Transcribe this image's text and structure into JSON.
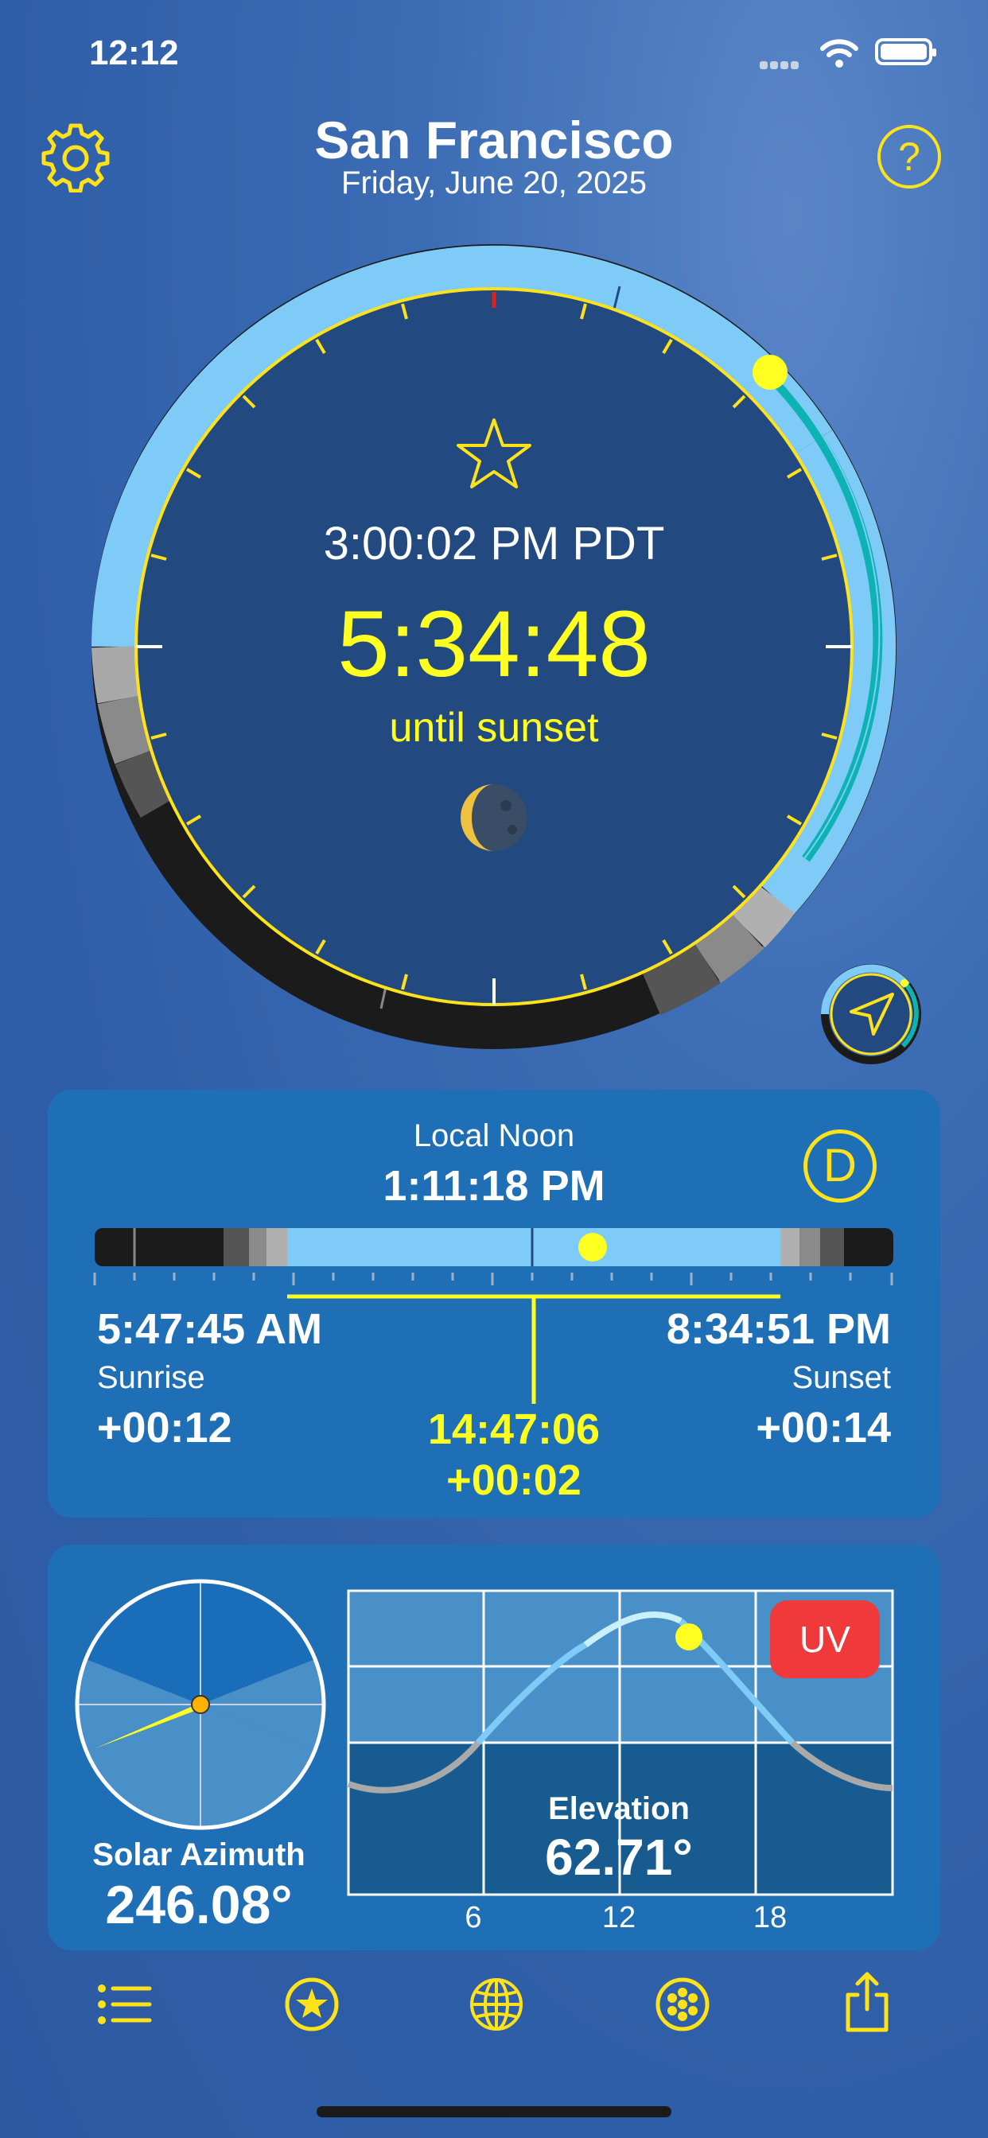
{
  "status": {
    "time": "12:12"
  },
  "header": {
    "city": "San Francisco",
    "date": "Friday, June 20, 2025",
    "help_label": "?"
  },
  "dial": {
    "clock_time": "3:00:02 PM PDT",
    "countdown": "5:34:48",
    "countdown_caption": "until sunset"
  },
  "day_panel": {
    "local_noon_label": "Local Noon",
    "local_noon_time": "1:11:18 PM",
    "mode_button": "D",
    "sunrise_time": "5:47:45 AM",
    "sunrise_label": "Sunrise",
    "sunrise_delta": "+00:12",
    "sunset_time": "8:34:51 PM",
    "sunset_label": "Sunset",
    "sunset_delta": "+00:14",
    "day_length": "14:47:06",
    "day_length_delta": "+00:02"
  },
  "sun_panel": {
    "azimuth_label": "Solar Azimuth",
    "azimuth_value": "246.08°",
    "uv_button": "UV",
    "elevation_label": "Elevation",
    "elevation_value": "62.71°",
    "x_ticks": [
      "6",
      "12",
      "18"
    ]
  },
  "tabbar": {
    "items": [
      "list-icon",
      "star-icon",
      "globe-icon",
      "dots-icon",
      "share-icon"
    ]
  },
  "colors": {
    "accent": "#ffe21a",
    "highlight": "#ffff22",
    "day_sky": "#7ecbf8",
    "night": "#1b1b1b",
    "teal": "#0db3b3",
    "uv": "#f0393a"
  }
}
